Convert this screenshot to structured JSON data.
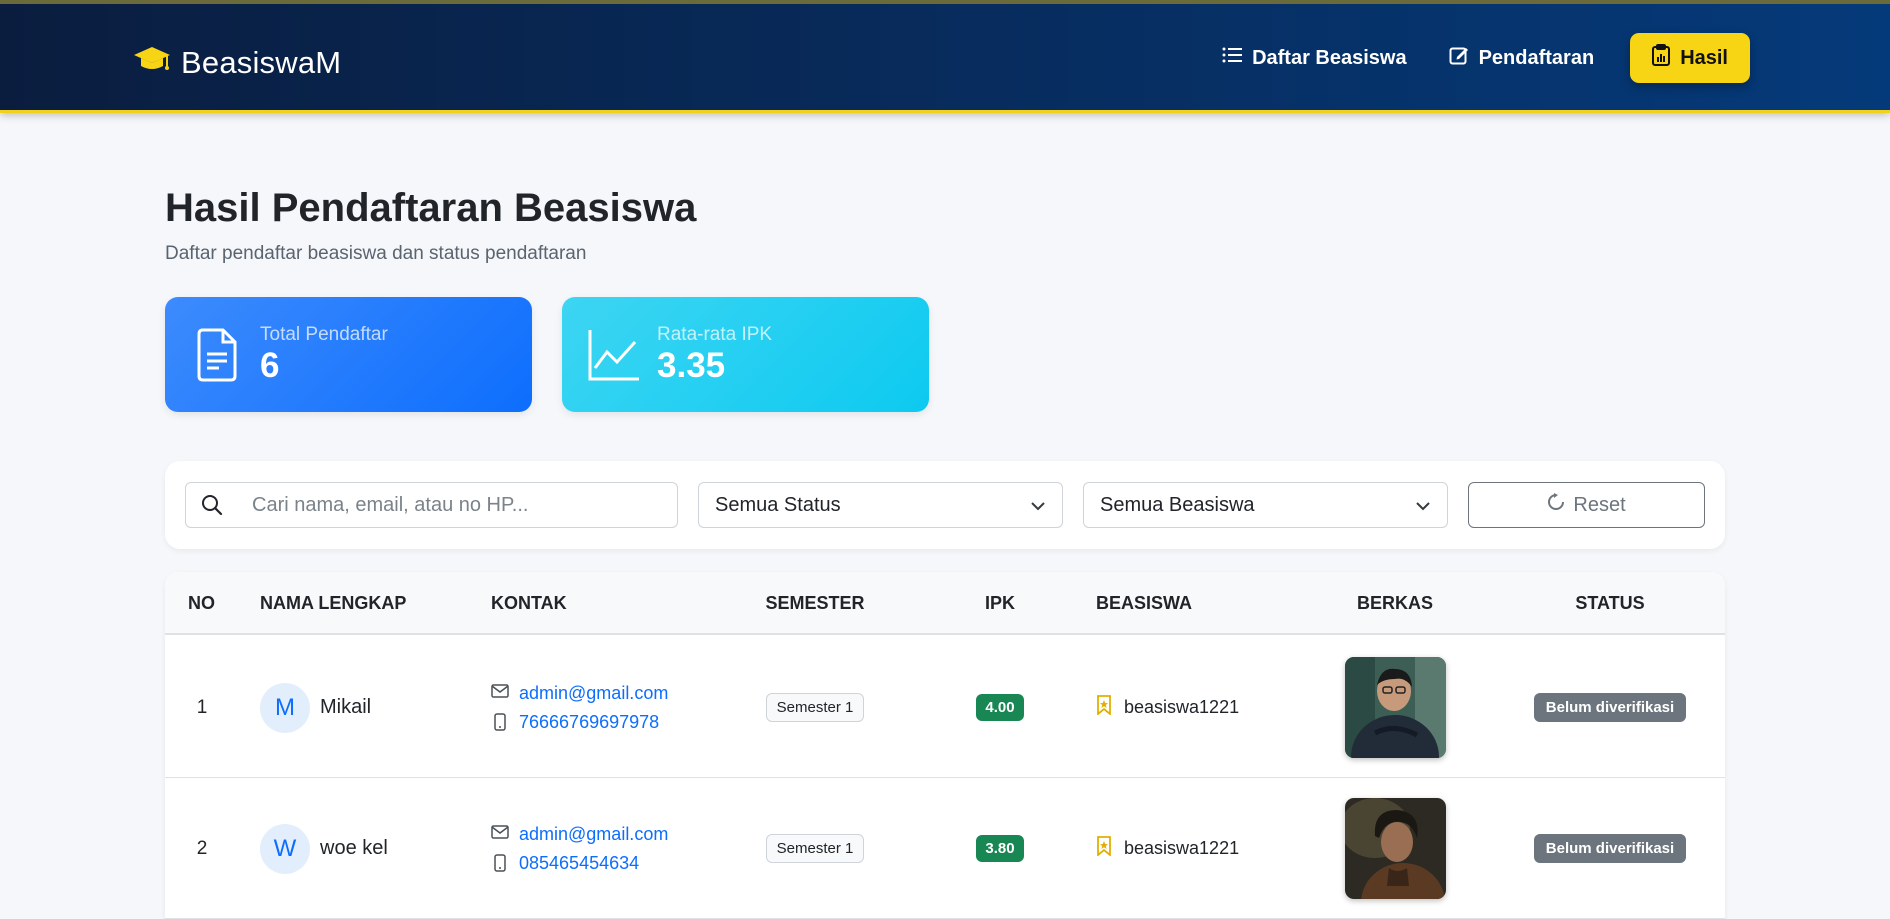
{
  "brand": {
    "name": "BeasiswaM"
  },
  "nav": [
    {
      "label": "Daftar Beasiswa"
    },
    {
      "label": "Pendaftaran"
    },
    {
      "label": "Hasil",
      "active": true
    }
  ],
  "page": {
    "title": "Hasil Pendaftaran Beasiswa",
    "subtitle": "Daftar pendaftar beasiswa dan status pendaftaran"
  },
  "stats": {
    "total": {
      "label": "Total Pendaftar",
      "value": "6"
    },
    "ipk": {
      "label": "Rata-rata IPK",
      "value": "3.35"
    }
  },
  "filters": {
    "search_placeholder": "Cari nama, email, atau no HP...",
    "status_selected": "Semua Status",
    "beasiswa_selected": "Semua Beasiswa",
    "reset_label": "Reset"
  },
  "table": {
    "headers": [
      "NO",
      "NAMA LENGKAP",
      "KONTAK",
      "SEMESTER",
      "IPK",
      "BEASISWA",
      "BERKAS",
      "STATUS"
    ],
    "rows": [
      {
        "no": "1",
        "initial": "M",
        "name": "Mikail",
        "email": "admin@gmail.com",
        "phone": "76666769697978",
        "semester": "Semester 1",
        "ipk": "4.00",
        "beasiswa": "beasiswa1221",
        "status": "Belum diverifikasi"
      },
      {
        "no": "2",
        "initial": "W",
        "name": "woe kel",
        "email": "admin@gmail.com",
        "phone": "085465454634",
        "semester": "Semester 1",
        "ipk": "3.80",
        "beasiswa": "beasiswa1221",
        "status": "Belum diverifikasi"
      }
    ]
  },
  "colors": {
    "navbar_start": "#0a1d3f",
    "navbar_end": "#053a7a",
    "accent_yellow": "#f7d414",
    "primary_blue": "#0d6efd",
    "info_cyan": "#0dcaf0",
    "success_green": "#198754",
    "secondary_gray": "#6c757d"
  }
}
